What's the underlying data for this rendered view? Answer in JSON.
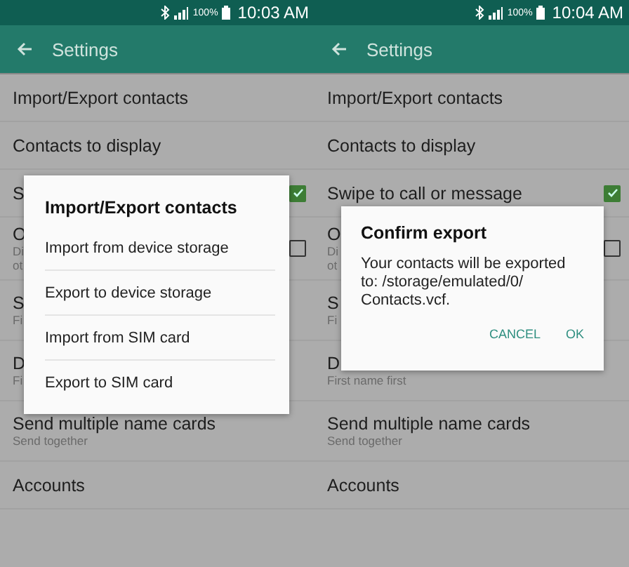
{
  "screens": [
    {
      "status_bar": {
        "battery": "100%",
        "time": "10:03 AM"
      },
      "app_bar": {
        "title": "Settings"
      },
      "rows": [
        {
          "title": "Import/Export contacts"
        },
        {
          "title": "Contacts to display"
        },
        {
          "title": "S",
          "checked": true
        },
        {
          "title": "O",
          "subtitle_lines": [
            "Di",
            "ot"
          ],
          "checked": false
        },
        {
          "title": "S",
          "subtitle_lines": [
            "Fi"
          ]
        },
        {
          "title": "D",
          "subtitle_lines": [
            "Fi"
          ]
        },
        {
          "title": "Send multiple name cards",
          "subtitle_lines": [
            "Send together"
          ]
        },
        {
          "title": "Accounts"
        }
      ],
      "dialog": {
        "kind": "list",
        "title": "Import/Export contacts",
        "items": [
          "Import from device storage",
          "Export to device storage",
          "Import from SIM card",
          "Export to SIM card"
        ]
      }
    },
    {
      "status_bar": {
        "battery": "100%",
        "time": "10:04 AM"
      },
      "app_bar": {
        "title": "Settings"
      },
      "rows": [
        {
          "title": "Import/Export contacts"
        },
        {
          "title": "Contacts to display"
        },
        {
          "title": "Swipe to call or message",
          "checked": true
        },
        {
          "title": "O",
          "subtitle_lines": [
            "Di",
            "ot"
          ],
          "checked": false
        },
        {
          "title": "S",
          "subtitle_lines": [
            "Fi"
          ]
        },
        {
          "title": "D",
          "subtitle_lines": [
            "First name first"
          ]
        },
        {
          "title": "Send multiple name cards",
          "subtitle_lines": [
            "Send together"
          ]
        },
        {
          "title": "Accounts"
        }
      ],
      "dialog": {
        "kind": "confirm",
        "title": "Confirm export",
        "message": "Your contacts will be exported to: /storage/emulated/0/ Contacts.vcf.",
        "buttons": [
          "CANCEL",
          "OK"
        ]
      }
    }
  ]
}
